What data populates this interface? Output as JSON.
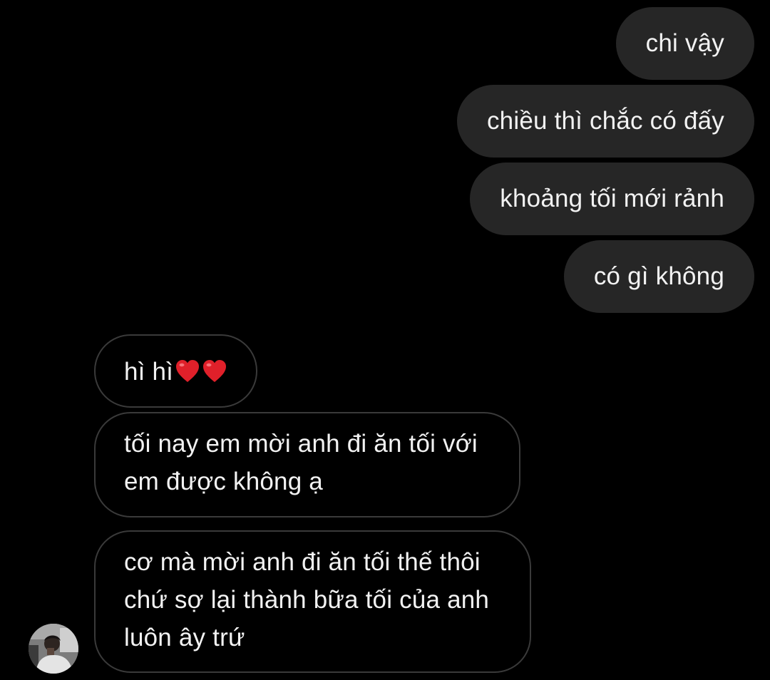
{
  "thread": {
    "outgoing": [
      {
        "text": "chi vậy"
      },
      {
        "text": "chiều thì chắc có đấy"
      },
      {
        "text": "khoảng tối mới rảnh"
      },
      {
        "text": "có gì không"
      }
    ],
    "incoming": [
      {
        "text": "hì hì",
        "emoji": [
          "red-heart",
          "red-heart"
        ]
      },
      {
        "lines": [
          "tối nay em mời anh đi ăn tối với",
          "em được không ạ"
        ]
      },
      {
        "lines": [
          "cơ mà mời anh đi ăn tối thế thôi",
          "chứ sợ lại thành bữa tối của anh",
          "luôn ây trứ"
        ]
      }
    ]
  },
  "colors": {
    "background": "#000000",
    "outgoing_bubble": "#262626",
    "incoming_border": "#3a3a3a",
    "text": "#f2f2f2",
    "heart": "#e0202a"
  }
}
